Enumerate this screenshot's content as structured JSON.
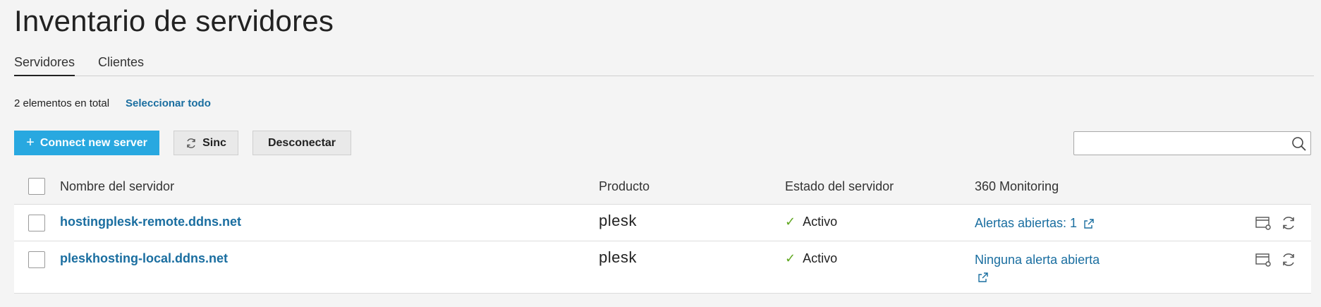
{
  "page": {
    "title": "Inventario de servidores"
  },
  "tabs": [
    {
      "label": "Servidores",
      "active": true
    },
    {
      "label": "Clientes",
      "active": false
    }
  ],
  "toolbar": {
    "total_text": "2 elementos en total",
    "select_all": "Seleccionar todo",
    "connect_label": "Connect new server",
    "sync_label": "Sinc",
    "disconnect_label": "Desconectar",
    "search_placeholder": ""
  },
  "table": {
    "headers": {
      "name": "Nombre del servidor",
      "product": "Producto",
      "status": "Estado del servidor",
      "monitoring": "360 Monitoring"
    },
    "rows": [
      {
        "name": "hostingplesk-remote.ddns.net",
        "product": "plesk",
        "status": "Activo",
        "monitoring": "Alertas abiertas: 1"
      },
      {
        "name": "pleskhosting-local.ddns.net",
        "product": "plesk",
        "status": "Activo",
        "monitoring": "Ninguna alerta abierta"
      }
    ]
  },
  "colors": {
    "accent": "#28a8e0",
    "link": "#1a6ea0",
    "ok": "#5fa71f"
  }
}
